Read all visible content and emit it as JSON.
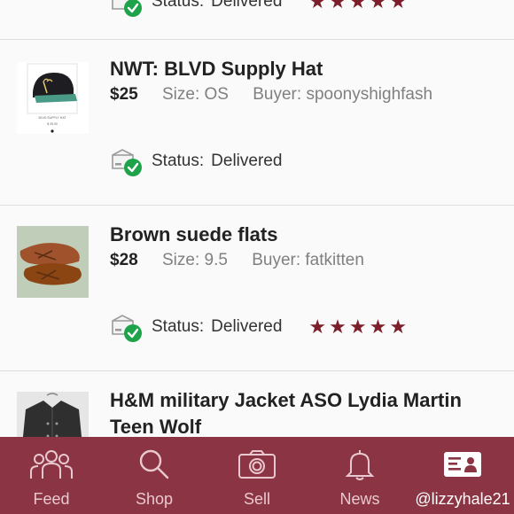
{
  "listings": [
    {
      "status_label": "Status:",
      "status_value": "Delivered",
      "rating": 5
    },
    {
      "title": "NWT: BLVD Supply Hat",
      "price": "$25",
      "size": "Size: OS",
      "buyer": "Buyer: spoonyshighfash",
      "status_label": "Status:",
      "status_value": "Delivered",
      "rating": 0,
      "thumb_caption": "BLVD SUPPLY HAT",
      "thumb_price": "$ 25.00"
    },
    {
      "title": "Brown suede flats",
      "price": "$28",
      "size": "Size: 9.5",
      "buyer": "Buyer: fatkitten",
      "status_label": "Status:",
      "status_value": "Delivered",
      "rating": 5
    },
    {
      "title": "H&M military Jacket ASO Lydia Martin Teen Wolf"
    }
  ],
  "nav": {
    "feed": "Feed",
    "shop": "Shop",
    "sell": "Sell",
    "news": "News",
    "profile": "@lizzyhale21"
  },
  "icons": {
    "feed": "people-icon",
    "shop": "search-icon",
    "sell": "camera-icon",
    "news": "bell-icon",
    "profile": "profile-card-icon",
    "status": "delivered-box-icon",
    "star": "star-icon"
  },
  "colors": {
    "nav_bg": "#8b3443",
    "star": "#7c1f2a",
    "check_green": "#1fa34a"
  }
}
